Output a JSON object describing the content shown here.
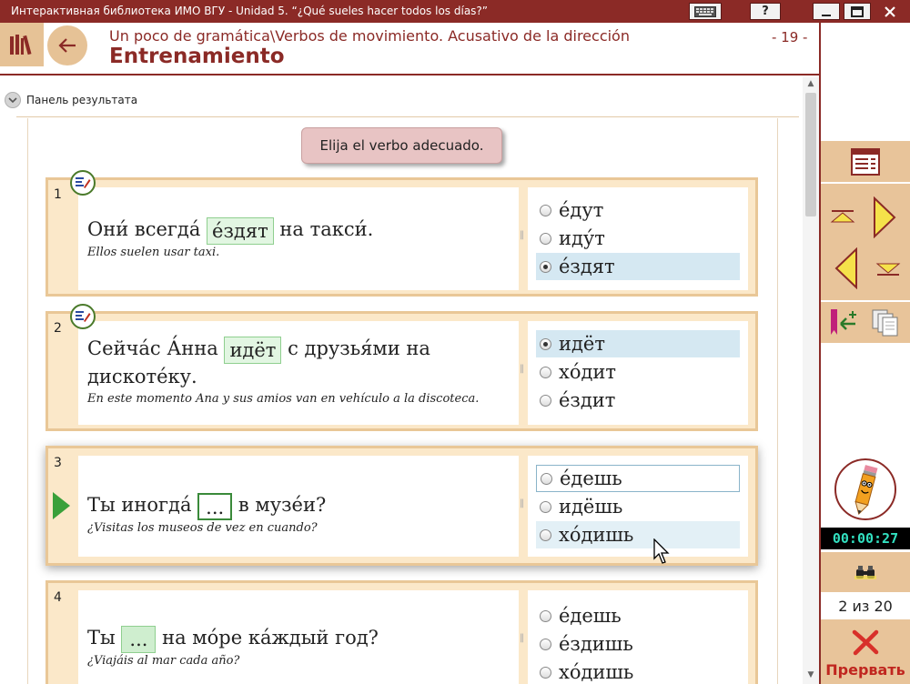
{
  "window": {
    "title": "Интерактивная библиотека ИМО ВГУ  -  Unidad 5. “¿Qué sueles hacer todos los días?”",
    "help_label": "?"
  },
  "header": {
    "breadcrumb": "Un poco de gramática\\Verbos de movimiento. Acusativo de la dirección",
    "title": "Entrenamiento",
    "page_number": "- 19 -"
  },
  "result_panel": {
    "label": "Панель результата"
  },
  "instruction": "Elija el verbo adecuado.",
  "exercises": [
    {
      "number": "1",
      "before": "Они́ всегда́",
      "answer": "е́здят",
      "after": "на такси́.",
      "translation": "Ellos suelen usar taxi.",
      "options": [
        "е́дут",
        "иду́т",
        "е́здят"
      ],
      "selected": "е́здят"
    },
    {
      "number": "2",
      "before": "Сейча́с А́нна",
      "answer": "идёт",
      "after": "с друзья́ми на",
      "line2": "дискоте́ку.",
      "translation": "En este momento Ana y sus amios van en vehículo a la discoteca.",
      "options": [
        "идёт",
        "хо́дит",
        "е́здит"
      ],
      "selected": "идёт"
    },
    {
      "number": "3",
      "before": "Ты иногда́",
      "answer": "...",
      "after": "в музе́и?",
      "translation": "¿Visitas los museos de vez en cuando?",
      "options": [
        "е́дешь",
        "идёшь",
        "хо́дишь"
      ],
      "selected": ""
    },
    {
      "number": "4",
      "before": "Ты",
      "answer": "...",
      "after": "на мо́ре ка́ждый год?",
      "translation": "¿Viajáis al mar cada año?",
      "options": [
        "е́дешь",
        "е́здишь",
        "хо́дишь"
      ],
      "selected": ""
    }
  ],
  "sidebar": {
    "timer": "00:00:27",
    "progress": "2 из 20",
    "abort_label": "Прервать"
  }
}
